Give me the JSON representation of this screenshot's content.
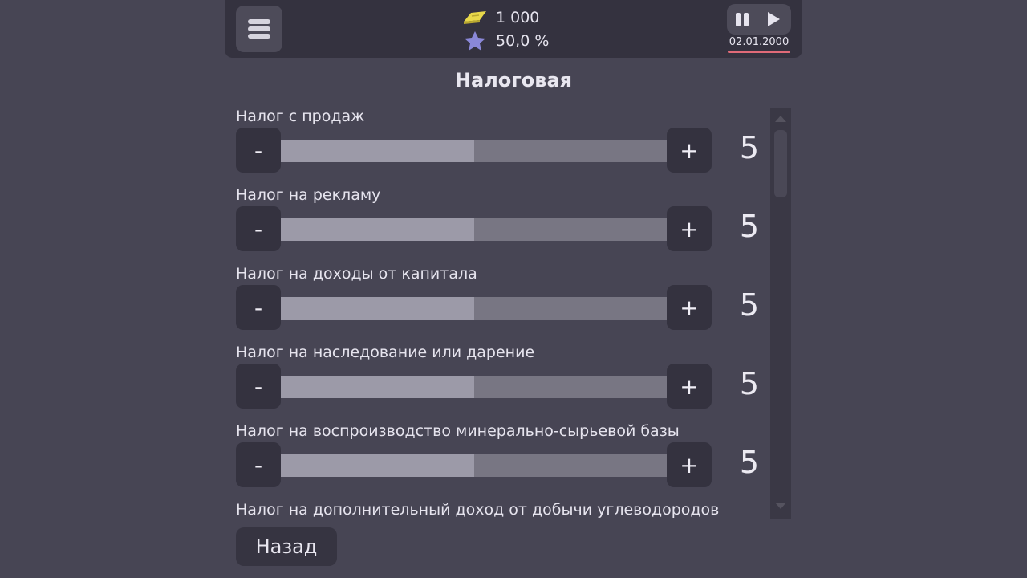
{
  "header": {
    "money": "1 000",
    "rating": "50,0 %",
    "date": "02.01.2000",
    "menu_icon": "hamburger-icon",
    "money_icon": "gold-bar-icon",
    "rating_icon": "star-icon"
  },
  "title": "Налоговая",
  "taxes": [
    {
      "label": "Налог с продаж",
      "value": "5",
      "minus": "-",
      "plus": "+",
      "level": 0.5
    },
    {
      "label": "Налог на рекламу",
      "value": "5",
      "minus": "-",
      "plus": "+",
      "level": 0.5
    },
    {
      "label": "Налог на доходы от капитала",
      "value": "5",
      "minus": "-",
      "plus": "+",
      "level": 0.5
    },
    {
      "label": "Налог на наследование или дарение",
      "value": "5",
      "minus": "-",
      "plus": "+",
      "level": 0.5
    },
    {
      "label": "Налог на воспроизводство минерально-сырьевой базы",
      "value": "5",
      "minus": "-",
      "plus": "+",
      "level": 0.5
    },
    {
      "label": "Налог на дополнительный доход от добычи углеводородов"
    }
  ],
  "back_label": "Назад",
  "colors": {
    "background": "#474554",
    "panel": "#34323f",
    "slider_fill": "#9c9aa8",
    "slider_track": "#787683",
    "date_underline": "#e06a78",
    "star": "#8a88d8",
    "gold": "#e8d84a"
  }
}
